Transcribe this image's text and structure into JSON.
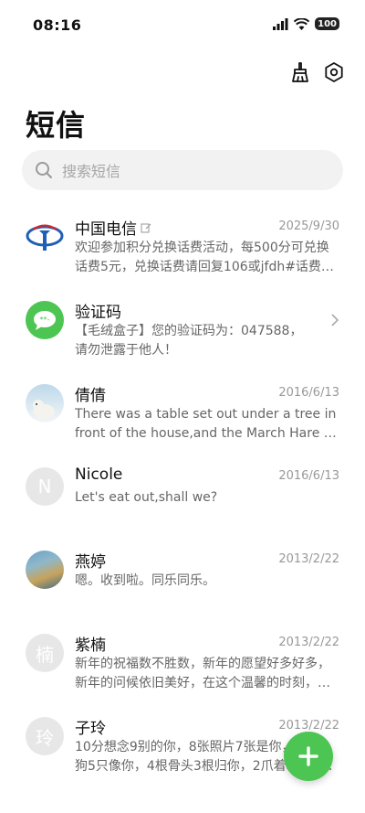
{
  "status_bar": {
    "time": "08:16",
    "battery": "100"
  },
  "toolbar": {
    "cleaner_icon": "broom-icon",
    "settings_icon": "settings-hexagon-icon"
  },
  "page": {
    "title": "短信"
  },
  "search": {
    "placeholder": "搜索短信"
  },
  "colors": {
    "accent": "#4cc552",
    "search_bg": "#f2f2f2",
    "telecom_blue": "#1f5fb5",
    "date_gray": "#999999"
  },
  "conversations": [
    {
      "name": "中国电信",
      "date": "2025/9/30",
      "preview_line1": "欢迎参加积分兑换话费活动，每500分可兑换",
      "preview_line2": "话费5元，兑换话费请回复106或jfdh#话费…",
      "avatar": "china-telecom-logo"
    },
    {
      "name": "验证码",
      "date": "",
      "preview_line1": "【毛绒盒子】您的验证码为：047588，",
      "preview_line2": "请勿泄露于他人！",
      "avatar": "verification-code-icon"
    },
    {
      "name": "倩倩",
      "date": "2016/6/13",
      "preview_line1": "There was a table set out under a tree in",
      "preview_line2": "front of the house,and the March Hare an…",
      "avatar": "polar-bear-photo"
    },
    {
      "name": "Nicole",
      "date": "2016/6/13",
      "preview_line1": "Let's eat out,shall we?",
      "preview_line2": "",
      "avatar_letter": "N"
    },
    {
      "name": "燕婷",
      "date": "2013/2/22",
      "preview_line1": "嗯。收到啦。同乐同乐。",
      "preview_line2": "",
      "avatar": "landscape-photo"
    },
    {
      "name": "紫楠",
      "date": "2013/2/22",
      "preview_line1": "新年的祝福数不胜数，新年的愿望好多好多，",
      "preview_line2": "新年的问候依旧美好，在这个温馨的时刻，…",
      "avatar_letter": "楠"
    },
    {
      "name": "子玲",
      "date": "2013/2/22",
      "preview_line1": "10分想念9别的你，8张照片7张是你，6只小",
      "preview_line2": "狗5只像你，4根骨头3根归你，2爪着地1定…",
      "avatar_letter": "玲"
    }
  ],
  "fab": {
    "icon": "plus-icon"
  }
}
